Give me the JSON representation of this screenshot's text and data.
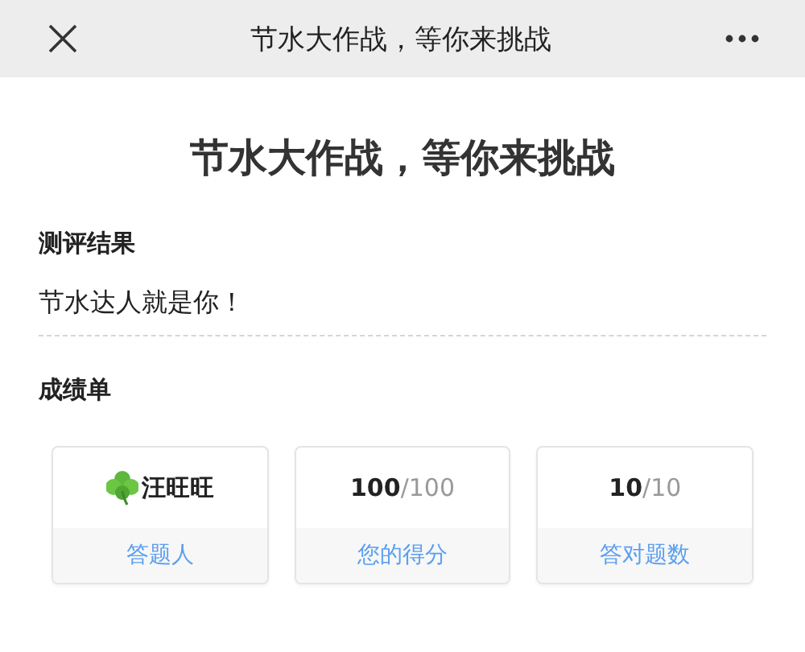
{
  "nav_bar": {
    "title": "节水大作战，等你来挑战"
  },
  "page_title": "节水大作战，等你来挑战",
  "result": {
    "heading": "测评结果",
    "text": "节水达人就是你！"
  },
  "scorecard": {
    "heading": "成绩单",
    "cards": [
      {
        "kind": "name",
        "value": "汪旺旺",
        "label": "答题人"
      },
      {
        "kind": "score",
        "value": "**100**/100",
        "label": "您的得分"
      },
      {
        "kind": "score",
        "value": "**10**/10",
        "label": "答对题数"
      }
    ]
  }
}
